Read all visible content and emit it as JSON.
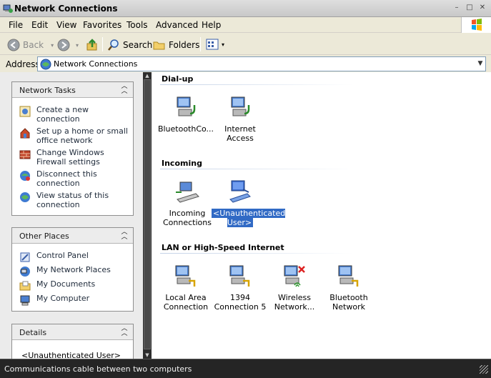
{
  "window": {
    "title": "Network Connections",
    "controls": [
      "–",
      "□",
      "✕"
    ]
  },
  "menu": [
    "File",
    "Edit",
    "View",
    "Favorites",
    "Tools",
    "Advanced",
    "Help"
  ],
  "toolbar": {
    "back": "Back",
    "search": "Search",
    "folders": "Folders"
  },
  "address": {
    "label": "Address",
    "value": "Network Connections"
  },
  "network_tasks": {
    "title": "Network Tasks",
    "items": [
      {
        "label": "Create a new connection",
        "icon": "new-connection-icon"
      },
      {
        "label": "Set up a home or small office network",
        "icon": "home-network-icon"
      },
      {
        "label": "Change Windows Firewall settings",
        "icon": "firewall-icon"
      },
      {
        "label": "Disconnect this connection",
        "icon": "disconnect-icon"
      },
      {
        "label": "View status of this connection",
        "icon": "status-icon"
      }
    ]
  },
  "other_places": {
    "title": "Other Places",
    "items": [
      {
        "label": "Control Panel",
        "icon": "control-panel-icon"
      },
      {
        "label": "My Network Places",
        "icon": "network-places-icon"
      },
      {
        "label": "My Documents",
        "icon": "documents-icon"
      },
      {
        "label": "My Computer",
        "icon": "computer-icon"
      }
    ]
  },
  "details": {
    "title": "Details",
    "value": "<Unauthenticated User>"
  },
  "groups": [
    {
      "title": "Dial-up",
      "items": [
        {
          "label": "BluetoothCo...",
          "icon": "dialup-icon"
        },
        {
          "label": "Internet Access",
          "icon": "dialup-icon"
        }
      ]
    },
    {
      "title": "Incoming",
      "items": [
        {
          "label": "Incoming Connections",
          "icon": "incoming-icon"
        },
        {
          "label": "<Unauthenticated User>",
          "icon": "incoming-user-icon",
          "selected": true
        }
      ]
    },
    {
      "title": "LAN or High-Speed Internet",
      "items": [
        {
          "label": "Local Area Connection",
          "icon": "lan-icon"
        },
        {
          "label": "1394 Connection 5",
          "icon": "lan-icon"
        },
        {
          "label": "Wireless Network...",
          "icon": "wireless-disabled-icon"
        },
        {
          "label": "Bluetooth Network",
          "icon": "lan-icon"
        }
      ]
    }
  ],
  "status": "Communications cable between two computers"
}
